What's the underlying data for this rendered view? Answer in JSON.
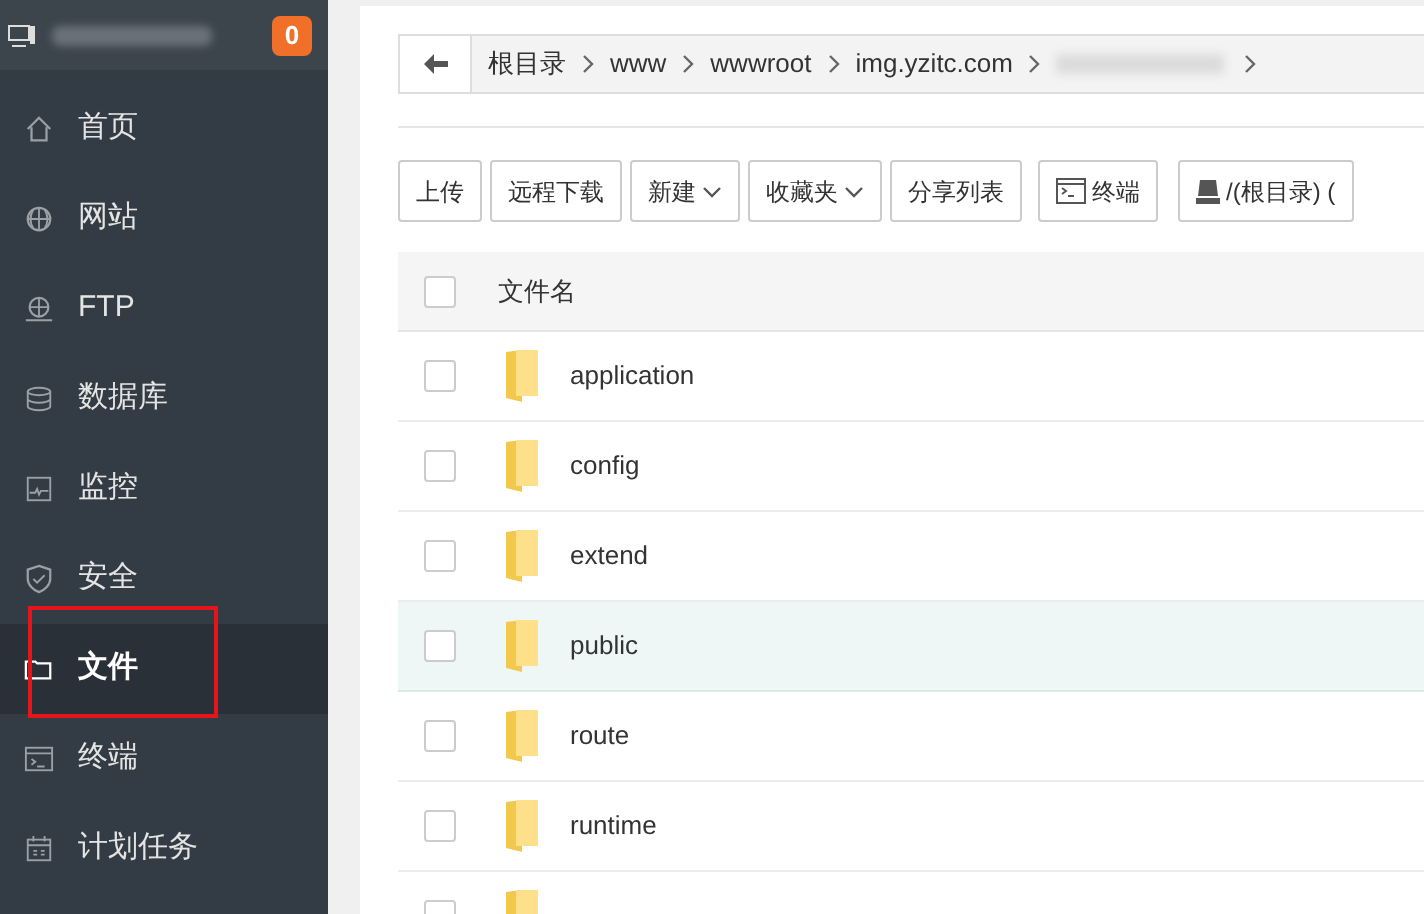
{
  "header": {
    "badge": "0"
  },
  "sidebar": {
    "items": [
      {
        "label": "首页",
        "selected": false
      },
      {
        "label": "网站",
        "selected": false
      },
      {
        "label": "FTP",
        "selected": false
      },
      {
        "label": "数据库",
        "selected": false
      },
      {
        "label": "监控",
        "selected": false
      },
      {
        "label": "安全",
        "selected": false
      },
      {
        "label": "文件",
        "selected": true
      },
      {
        "label": "终端",
        "selected": false
      },
      {
        "label": "计划任务",
        "selected": false
      }
    ]
  },
  "breadcrumb": [
    "根目录",
    "www",
    "wwwroot",
    "img.yzitc.com"
  ],
  "toolbar": [
    {
      "label": "上传",
      "kind": "plain"
    },
    {
      "label": "远程下载",
      "kind": "plain"
    },
    {
      "label": "新建",
      "kind": "dropdown"
    },
    {
      "label": "收藏夹",
      "kind": "dropdown"
    },
    {
      "label": "分享列表",
      "kind": "plain"
    },
    {
      "label": "终端",
      "kind": "terminal"
    },
    {
      "label": "/(根目录) (",
      "kind": "disk"
    }
  ],
  "table": {
    "select_all_checked": false,
    "columns": [
      "文件名"
    ],
    "rows": [
      {
        "name": "application",
        "checked": false,
        "highlighted": false
      },
      {
        "name": "config",
        "checked": false,
        "highlighted": false
      },
      {
        "name": "extend",
        "checked": false,
        "highlighted": false
      },
      {
        "name": "public",
        "checked": false,
        "highlighted": true
      },
      {
        "name": "route",
        "checked": false,
        "highlighted": false
      },
      {
        "name": "runtime",
        "checked": false,
        "highlighted": false
      },
      {
        "checked": false,
        "highlighted": false
      }
    ]
  }
}
